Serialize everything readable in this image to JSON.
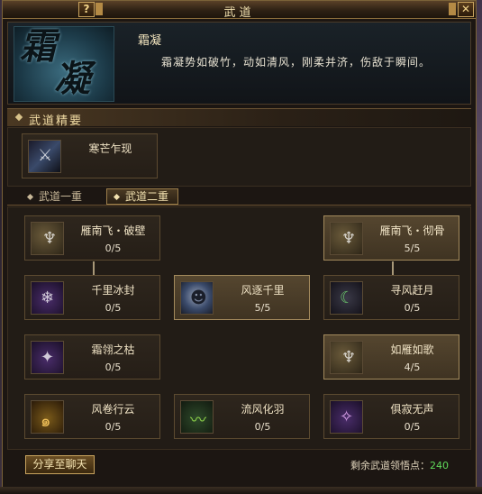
{
  "window": {
    "title": "武道",
    "help_label": "?",
    "close_label": "✕"
  },
  "header": {
    "emblem_chars": [
      "霜",
      "凝"
    ],
    "skill_name": "霜凝",
    "skill_desc": "霜凝势如破竹，动如清风，刚柔并济，伤敌于瞬间。"
  },
  "essence": {
    "section_label": "武道精要",
    "card": {
      "name": "寒芒乍现",
      "icon": "blade-icon"
    }
  },
  "tabs": [
    {
      "label": "武道一重",
      "active": false
    },
    {
      "label": "武道二重",
      "active": true
    }
  ],
  "skills": [
    {
      "name": "雁南飞・破壁",
      "count": "0/5",
      "icon": "feather-icon",
      "active": false
    },
    {
      "name": "雁南飞・彻骨",
      "count": "5/5",
      "icon": "feather-icon",
      "active": true
    },
    {
      "name": "千里冰封",
      "count": "0/5",
      "icon": "frost-swirl-icon",
      "active": false
    },
    {
      "name": "风逐千里",
      "count": "5/5",
      "icon": "ghost-mask-icon",
      "active": true
    },
    {
      "name": "寻风赶月",
      "count": "0/5",
      "icon": "wind-moon-icon",
      "active": false
    },
    {
      "name": "霜翎之枯",
      "count": "0/5",
      "icon": "frost-feather-icon",
      "active": false
    },
    {
      "name": "如雁如歌",
      "count": "4/5",
      "icon": "feather-icon",
      "active": true
    },
    {
      "name": "风卷行云",
      "count": "0/5",
      "icon": "cloud-swirl-icon",
      "active": false
    },
    {
      "name": "流风化羽",
      "count": "0/5",
      "icon": "green-wind-icon",
      "active": false
    },
    {
      "name": "俱寂无声",
      "count": "0/5",
      "icon": "silence-icon",
      "active": false
    }
  ],
  "footer": {
    "share_label": "分享至聊天",
    "remain_label": "剩余武道领悟点：",
    "remain_value": "240"
  }
}
